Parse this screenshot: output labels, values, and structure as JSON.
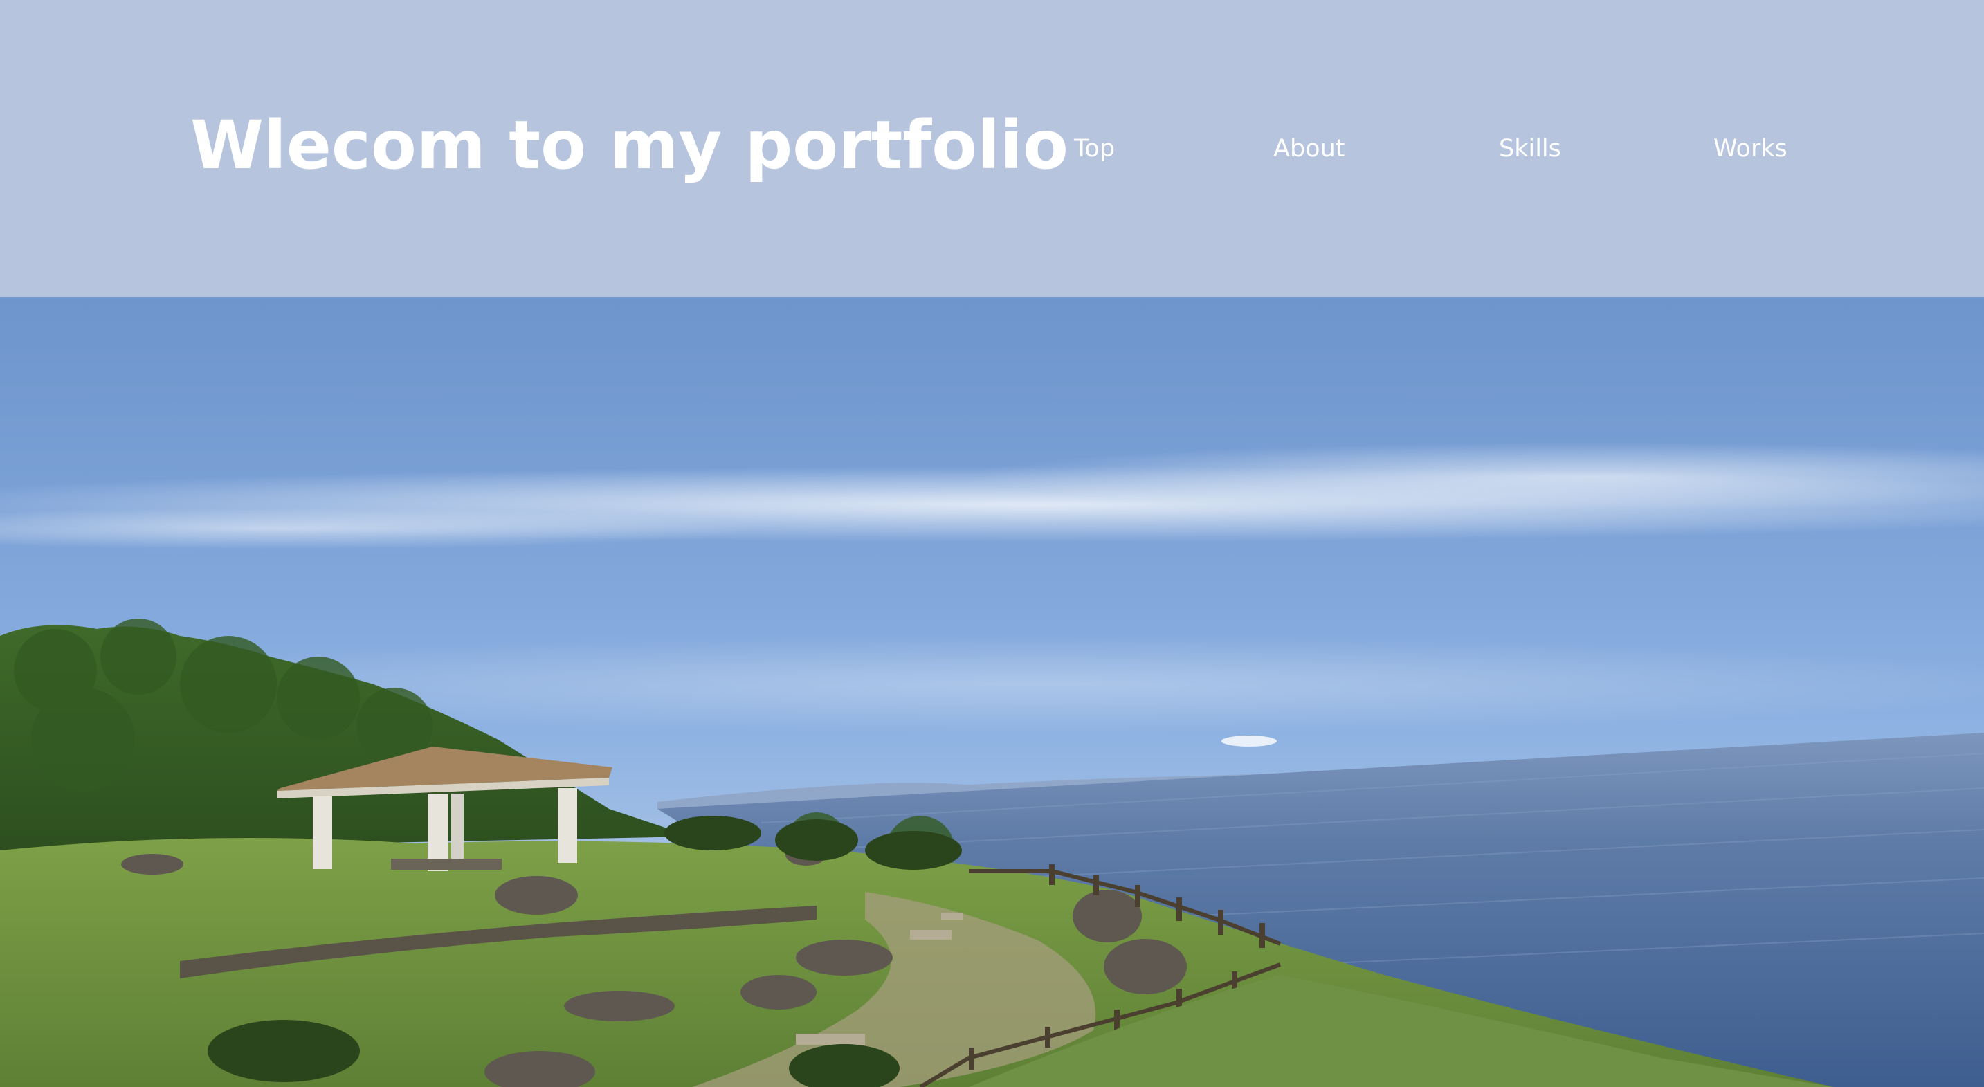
{
  "header": {
    "title": "Wlecom to my portfolio",
    "background_color": "#b6c5dd",
    "text_color": "#ffffff"
  },
  "nav": {
    "items": [
      {
        "label": "Top"
      },
      {
        "label": "About"
      },
      {
        "label": "Skills"
      },
      {
        "label": "Works"
      }
    ]
  },
  "hero": {
    "image_subject": "coastal-landscape-photo"
  }
}
